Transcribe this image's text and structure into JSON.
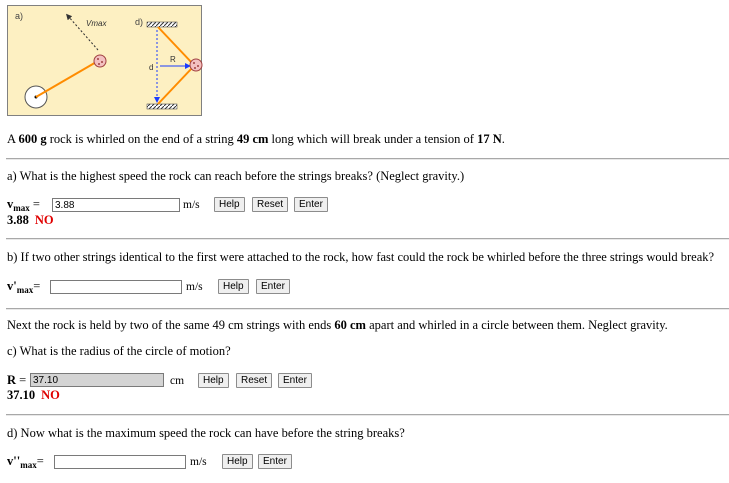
{
  "figure": {
    "label_a": "a)",
    "label_d": "d)",
    "label_vmax": "Vmax",
    "label_R": "R",
    "label_d_small": "d"
  },
  "problem": {
    "intro_pre": "A ",
    "mass": "600 g",
    "intro_mid1": " rock is whirled on the end of a string ",
    "length": "49 cm",
    "intro_mid2": " long which will break under a tension of ",
    "tension": "17 N",
    "intro_end": "."
  },
  "part_a": {
    "question": "a) What is the highest speed the rock can reach before the strings breaks? (Neglect gravity.)",
    "var_main": "v",
    "var_sub": "max",
    "equals": "=",
    "input_value": "3.88",
    "unit": "m/s",
    "help": "Help",
    "reset": "Reset",
    "enter": "Enter",
    "result_value": "3.88",
    "result_status": "NO"
  },
  "part_b": {
    "question": "b) If two other strings identical to the first were attached to the rock, how fast could the rock be whirled before the three strings would break?",
    "var_main": "v'",
    "var_sub": "max",
    "equals": "=",
    "input_value": "",
    "unit": "m/s",
    "help": "Help",
    "enter": "Enter"
  },
  "part_c": {
    "setup_pre": "Next the rock is held by two of the same 49 cm strings with ends ",
    "setup_dist": "60 cm",
    "setup_post": " apart and whirled in a circle between them. Neglect gravity.",
    "question": "c) What is the radius of the circle of motion?",
    "var_main": "R",
    "equals": "=",
    "input_value": "37.10",
    "unit": "cm",
    "help": "Help",
    "reset": "Reset",
    "enter": "Enter",
    "result_value": "37.10",
    "result_status": "NO"
  },
  "part_d": {
    "question": "d) Now what is the maximum speed the rock can have before the string breaks?",
    "var_main": "v''",
    "var_sub": "max",
    "equals": "=",
    "input_value": "",
    "unit": "m/s",
    "help": "Help",
    "enter": "Enter"
  }
}
